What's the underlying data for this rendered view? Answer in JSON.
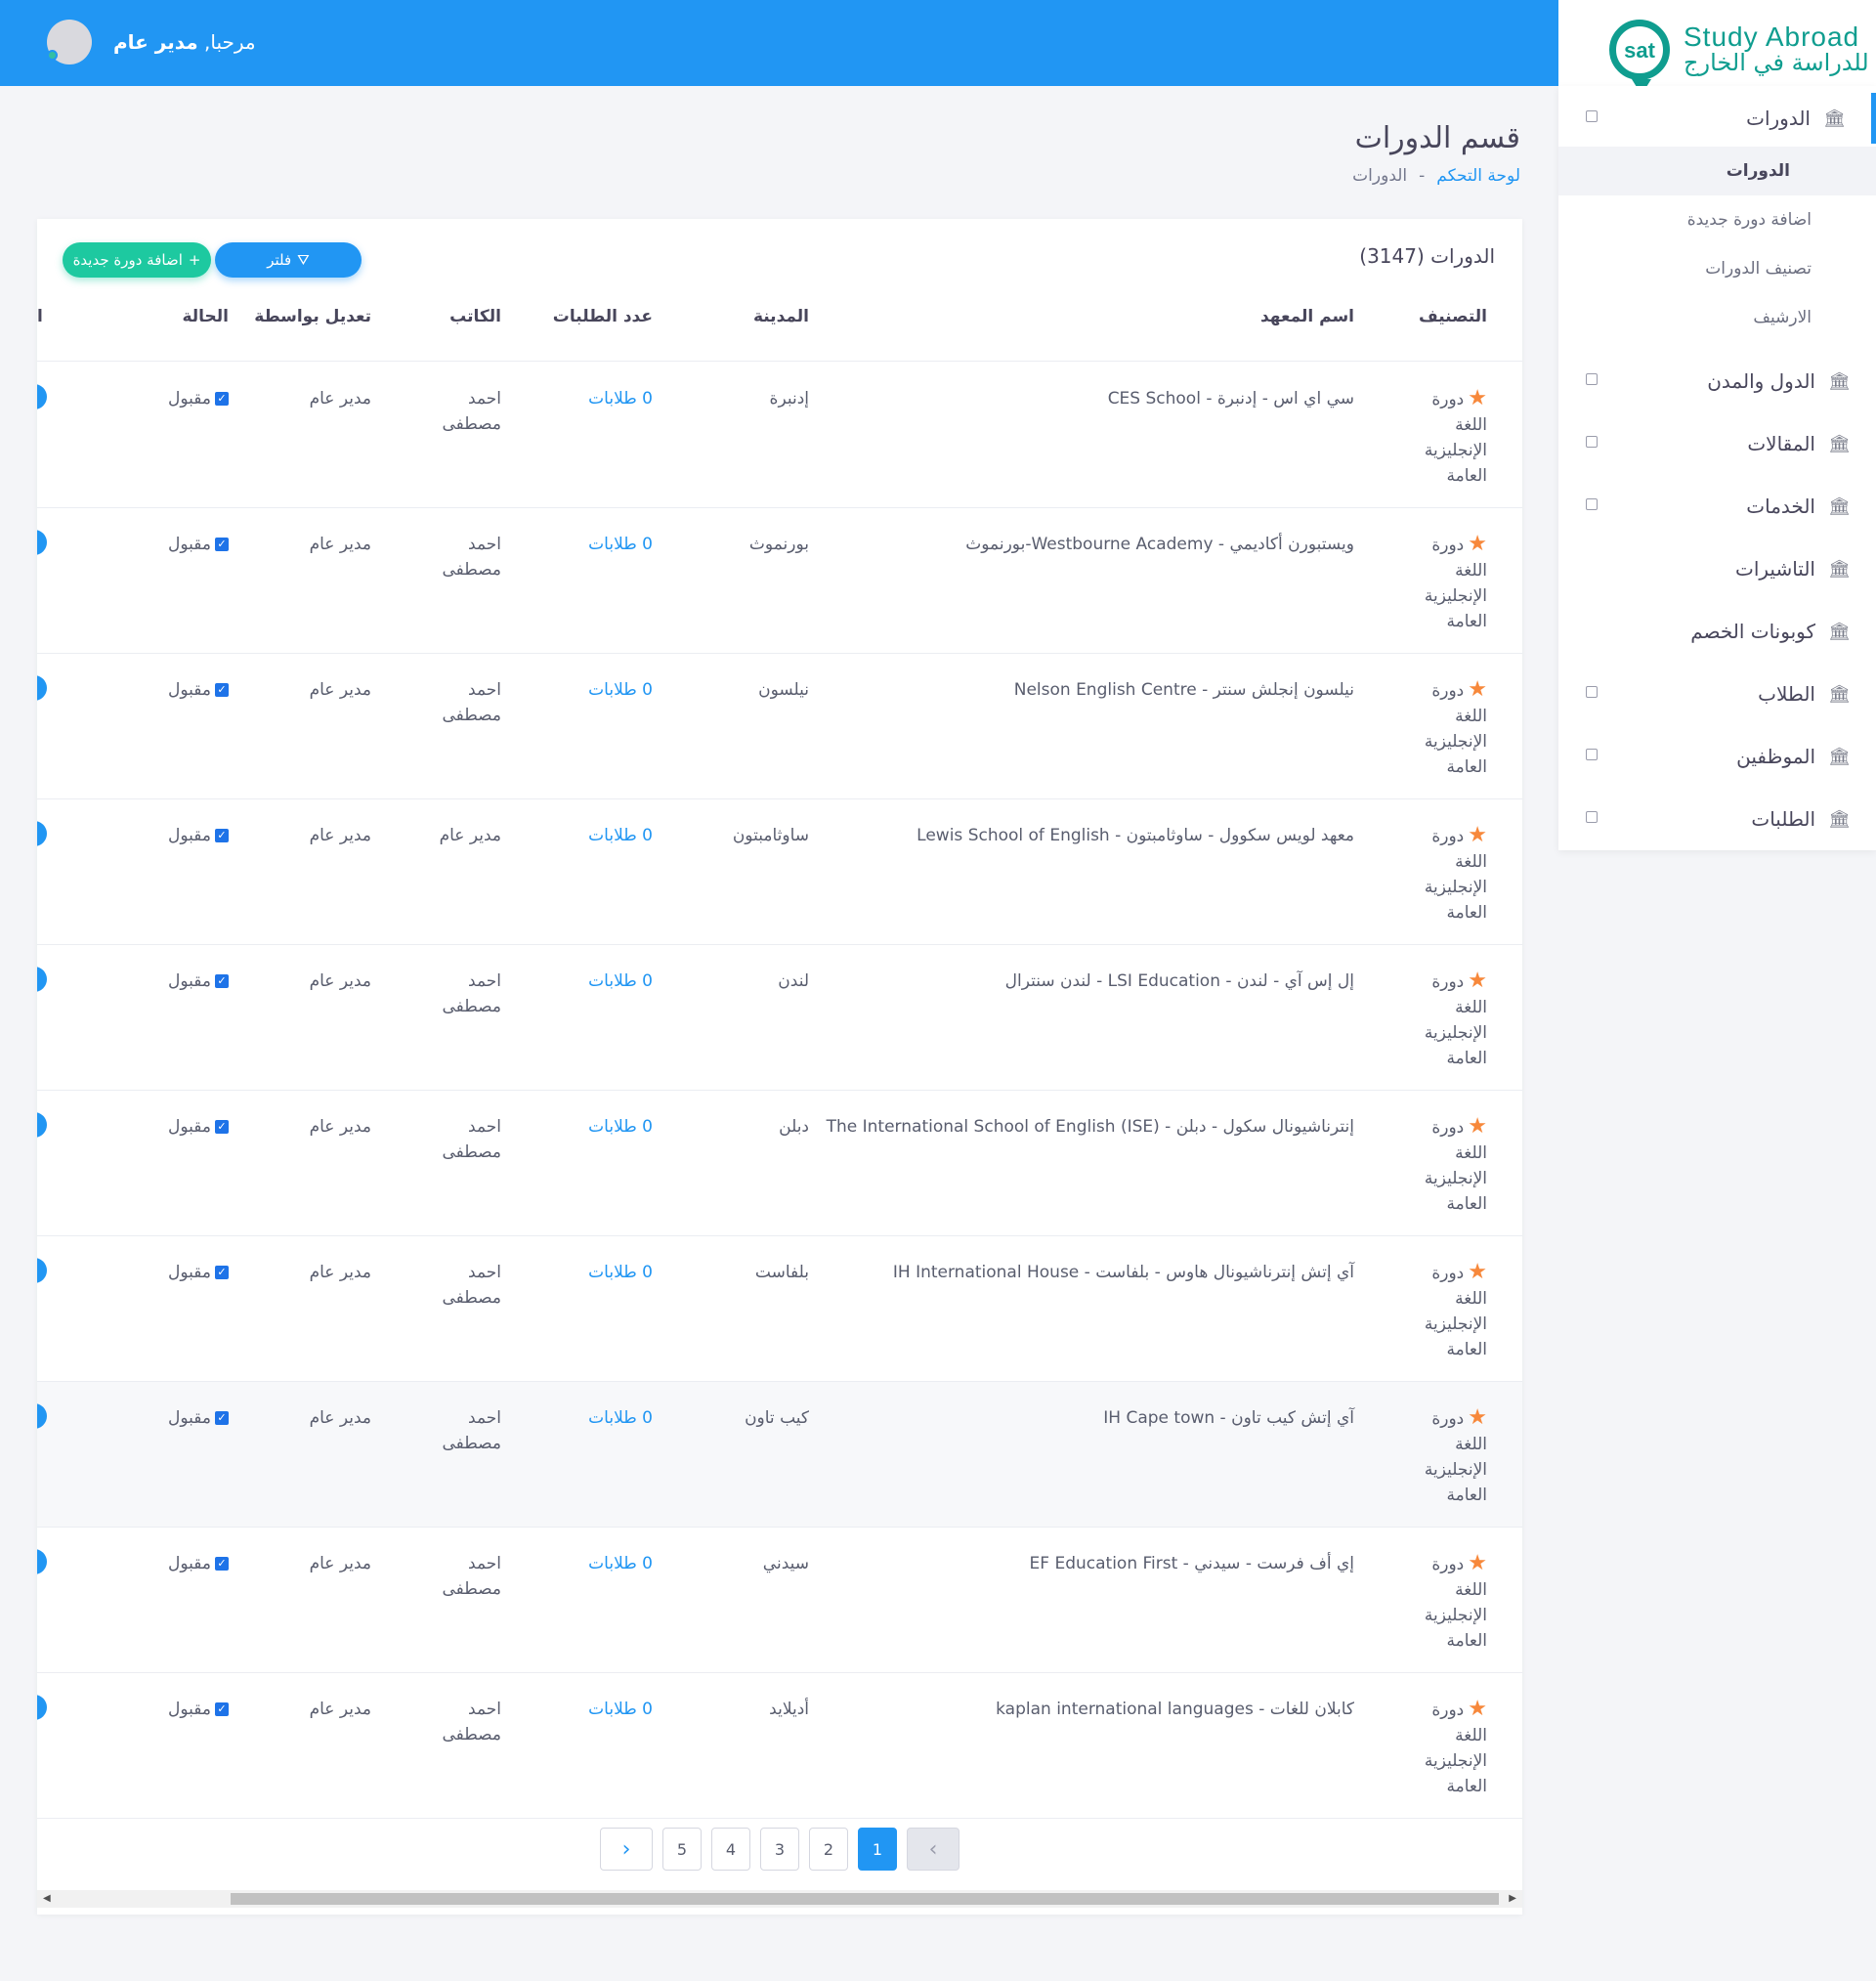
{
  "header": {
    "greeting": "مرحبا,",
    "user_name": "مدير عام"
  },
  "brand": {
    "mark": "sat",
    "name_en": "Study Abroad",
    "name_ar": "للدراسة في الخارج"
  },
  "sidebar": {
    "items": [
      {
        "label": "الدورات",
        "icon": "bank-icon",
        "active": true
      },
      {
        "label": "الدول والمدن",
        "icon": "bank-icon"
      },
      {
        "label": "المقالات",
        "icon": "bank-icon"
      },
      {
        "label": "الخدمات",
        "icon": "bank-icon"
      },
      {
        "label": "التاشيرات",
        "icon": "bank-icon"
      },
      {
        "label": "كوبونات الخصم",
        "icon": "bank-icon"
      },
      {
        "label": "الطلاب",
        "icon": "bank-icon"
      },
      {
        "label": "الموظفين",
        "icon": "bank-icon"
      },
      {
        "label": "الطلبات",
        "icon": "bank-icon"
      }
    ],
    "submenu": [
      "الدورات",
      "اضافة دورة جديدة",
      "تصنيف الدورات",
      "الارشيف"
    ]
  },
  "page": {
    "title": "قسم الدورات",
    "breadcrumb_home": "لوحة التحكم",
    "breadcrumb_sep": "-",
    "breadcrumb_current": "الدورات"
  },
  "card": {
    "title": "الدورات (3147)",
    "filter_label": "فلتر",
    "add_label": "اضافة دورة جديدة"
  },
  "table": {
    "columns": [
      "التصنيف",
      "اسم المعهد",
      "المدينة",
      "عدد الطلبات",
      "الكاتب",
      "تعديل بواسطة",
      "الحالة",
      "ا"
    ],
    "rows": [
      {
        "category": "دورة اللغة الإنجليزية العامة",
        "institute": "سي اي اس - إدنبرة - CES School",
        "city": "إدنبرة",
        "requests": "0 طلابات",
        "author": "احمد مصطفى",
        "editor": "مدير عام",
        "status": "مقبول"
      },
      {
        "category": "دورة اللغة الإنجليزية العامة",
        "institute": "ويستبورن أكاديمي - Westbourne Academy-بورنموث",
        "city": "بورنموث",
        "requests": "0 طلابات",
        "author": "احمد مصطفى",
        "editor": "مدير عام",
        "status": "مقبول"
      },
      {
        "category": "دورة اللغة الإنجليزية العامة",
        "institute": "نيلسون إنجلش سنتر - Nelson English Centre",
        "city": "نيلسون",
        "requests": "0 طلابات",
        "author": "احمد مصطفى",
        "editor": "مدير عام",
        "status": "مقبول"
      },
      {
        "category": "دورة اللغة الإنجليزية العامة",
        "institute": "معهد لويس سكوول - ساوثامبتون - Lewis School of English",
        "city": "ساوثامبتون",
        "requests": "0 طلابات",
        "author": "مدير عام",
        "editor": "مدير عام",
        "status": "مقبول"
      },
      {
        "category": "دورة اللغة الإنجليزية العامة",
        "institute": "إل إس آي - لندن - LSI Education - لندن سنترال",
        "city": "لندن",
        "requests": "0 طلابات",
        "author": "احمد مصطفى",
        "editor": "مدير عام",
        "status": "مقبول"
      },
      {
        "category": "دورة اللغة الإنجليزية العامة",
        "institute": "إنترناشيونال سكول - دبلن - The International School of English (ISE)",
        "city": "دبلن",
        "requests": "0 طلابات",
        "author": "احمد مصطفى",
        "editor": "مدير عام",
        "status": "مقبول"
      },
      {
        "category": "دورة اللغة الإنجليزية العامة",
        "institute": "آي إتش إنترناشيونال هاوس - بلفاست - IH International House",
        "city": "بلفاست",
        "requests": "0 طلابات",
        "author": "احمد مصطفى",
        "editor": "مدير عام",
        "status": "مقبول"
      },
      {
        "category": "دورة اللغة الإنجليزية العامة",
        "institute": "آي إتش كيب تاون - IH Cape town",
        "city": "كيب تاون",
        "requests": "0 طلابات",
        "author": "احمد مصطفى",
        "editor": "مدير عام",
        "status": "مقبول"
      },
      {
        "category": "دورة اللغة الإنجليزية العامة",
        "institute": "إي أف فرست - سيدني - EF Education First",
        "city": "سيدني",
        "requests": "0 طلابات",
        "author": "احمد مصطفى",
        "editor": "مدير عام",
        "status": "مقبول"
      },
      {
        "category": "دورة اللغة الإنجليزية العامة",
        "institute": "كابلان للغات - kaplan international languages",
        "city": "أديلايد",
        "requests": "0 طلابات",
        "author": "احمد مصطفى",
        "editor": "مدير عام",
        "status": "مقبول"
      }
    ]
  },
  "pagination": {
    "pages": [
      "1",
      "2",
      "3",
      "4",
      "5"
    ],
    "current": "1"
  }
}
